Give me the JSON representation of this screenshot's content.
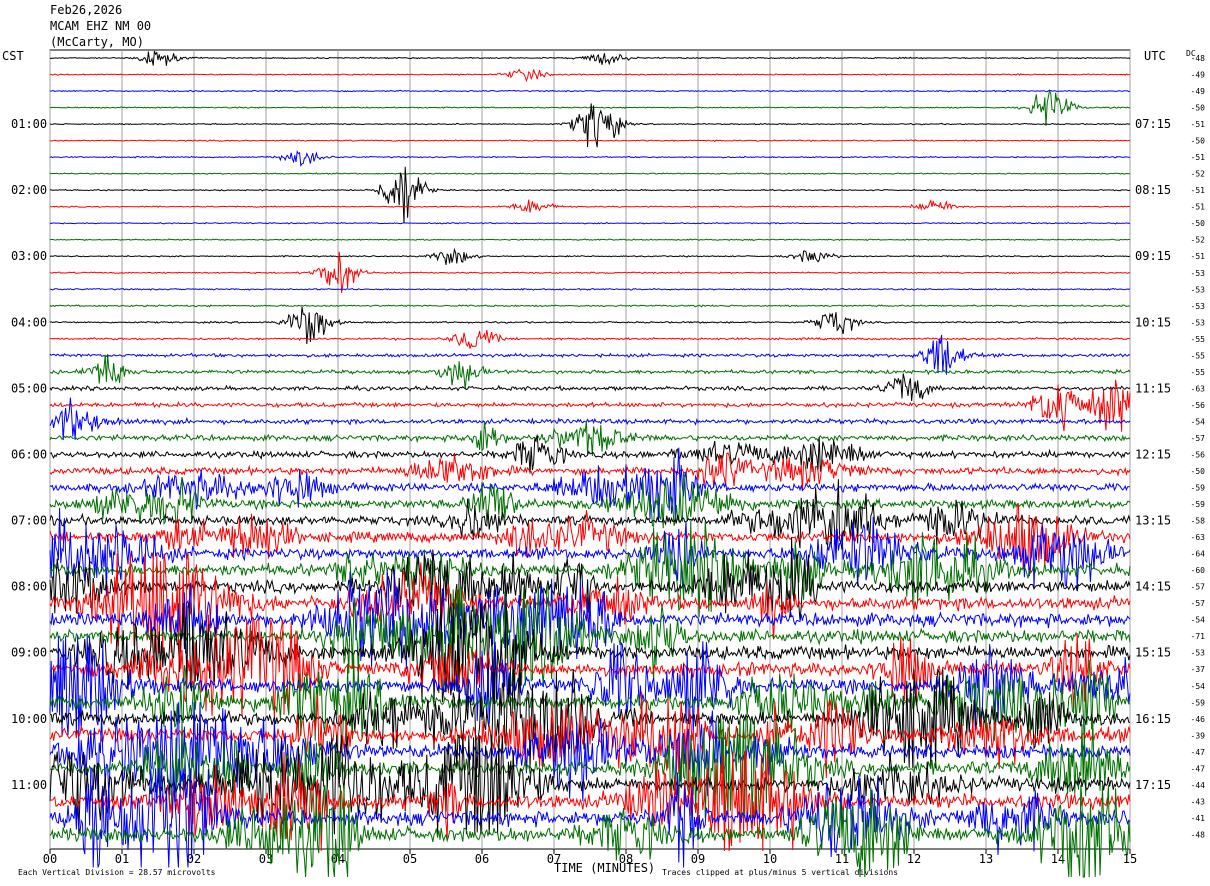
{
  "header": {
    "date": "Feb26,2026",
    "station": "MCAM EHZ NM 00",
    "location": "(McCarty, MO)"
  },
  "left_axis_title": "CST",
  "right_axis_title": "UTC",
  "dc_label": "DC",
  "xlabel": "TIME (MINUTES)",
  "footer_left": "Each Vertical Division = 28.57 microvolts",
  "footer_right": "Traces clipped at plus/minus 5 vertical divisions",
  "colors": {
    "series": [
      "#000000",
      "#ff0000",
      "#0000ff",
      "#007000"
    ],
    "grid": "#a0a0a0"
  },
  "chart_data": {
    "type": "line",
    "title": "",
    "xlabel": "TIME (MINUTES)",
    "xlim": [
      0,
      15
    ],
    "x_ticks": [
      "00",
      "01",
      "02",
      "03",
      "04",
      "05",
      "06",
      "07",
      "08",
      "09",
      "10",
      "11",
      "12",
      "13",
      "14",
      "15"
    ],
    "cst_ticks": [
      "01:00",
      "02:00",
      "03:00",
      "04:00",
      "05:00",
      "06:00",
      "07:00",
      "08:00",
      "09:00",
      "10:00",
      "11:00"
    ],
    "utc_ticks": [
      "07:15",
      "08:15",
      "09:15",
      "10:15",
      "11:15",
      "12:15",
      "13:15",
      "14:15",
      "15:15",
      "16:15",
      "17:15"
    ],
    "trace_count": 48,
    "dc_offsets": [
      -48,
      -49,
      -49,
      -50,
      -51,
      -50,
      -51,
      -52,
      -51,
      -51,
      -50,
      -52,
      -51,
      -53,
      -53,
      -53,
      -53,
      -55,
      -55,
      -55,
      -63,
      -56,
      -54,
      -57,
      -56,
      -50,
      -59,
      -59,
      -58,
      -63,
      -64,
      -60,
      -57,
      -57,
      -54,
      -71,
      -53,
      -37,
      -54,
      -59,
      -46,
      -39,
      -47,
      -47,
      -44,
      -43,
      -41,
      -48
    ],
    "trace_color_cycle": [
      "black",
      "red",
      "blue",
      "green"
    ],
    "activity": [
      0.3,
      0.3,
      0.3,
      0.3,
      0.3,
      0.3,
      0.3,
      0.3,
      0.3,
      0.3,
      0.3,
      0.3,
      0.3,
      0.35,
      0.35,
      0.4,
      0.4,
      0.5,
      0.8,
      0.9,
      1.0,
      1.1,
      1.2,
      1.4,
      1.6,
      1.8,
      2.0,
      2.2,
      2.4,
      2.6,
      2.8,
      3.0,
      3.1,
      3.2,
      3.3,
      3.3,
      3.4,
      3.4,
      3.5,
      3.5,
      3.5,
      3.6,
      3.6,
      3.6,
      3.6,
      3.7,
      3.7,
      3.7
    ],
    "events": [
      {
        "trace": 0,
        "minute": 1.5,
        "amp": 1.2
      },
      {
        "trace": 0,
        "minute": 7.7,
        "amp": 1.0
      },
      {
        "trace": 1,
        "minute": 6.6,
        "amp": 0.8
      },
      {
        "trace": 3,
        "minute": 13.9,
        "amp": 3.0
      },
      {
        "trace": 4,
        "minute": 7.6,
        "amp": 4.5
      },
      {
        "trace": 6,
        "minute": 3.5,
        "amp": 1.2
      },
      {
        "trace": 8,
        "minute": 4.9,
        "amp": 5.0
      },
      {
        "trace": 9,
        "minute": 6.7,
        "amp": 1.0
      },
      {
        "trace": 9,
        "minute": 12.3,
        "amp": 1.0
      },
      {
        "trace": 12,
        "minute": 5.6,
        "amp": 1.2
      },
      {
        "trace": 12,
        "minute": 10.6,
        "amp": 1.0
      },
      {
        "trace": 13,
        "minute": 4.0,
        "amp": 3.0
      },
      {
        "trace": 16,
        "minute": 3.6,
        "amp": 3.5
      },
      {
        "trace": 16,
        "minute": 10.9,
        "amp": 2.0
      },
      {
        "trace": 17,
        "minute": 5.9,
        "amp": 2.0
      },
      {
        "trace": 18,
        "minute": 12.4,
        "amp": 3.5
      },
      {
        "trace": 19,
        "minute": 0.8,
        "amp": 2.5
      },
      {
        "trace": 19,
        "minute": 5.7,
        "amp": 2.0
      },
      {
        "trace": 20,
        "minute": 11.9,
        "amp": 2.5
      },
      {
        "trace": 21,
        "minute": 14.8,
        "amp": 3.5
      }
    ]
  }
}
